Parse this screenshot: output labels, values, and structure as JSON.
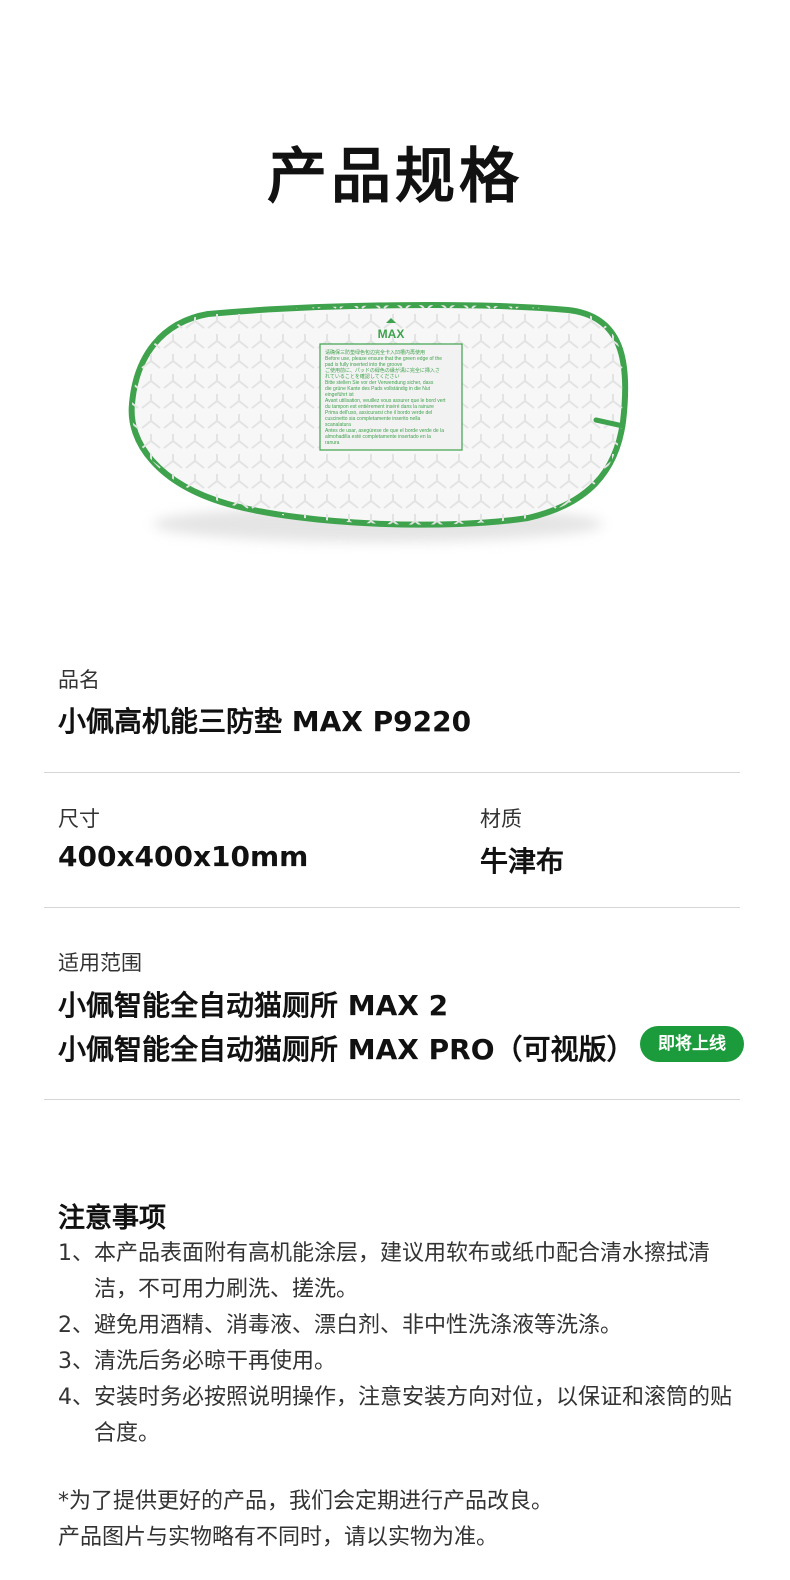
{
  "page_title": "产品规格",
  "product_image": {
    "pad_label": "MAX",
    "brand_color": "#3fa34d",
    "instructions": [
      "请确保三防垫绿色包边完全卡入凹槽内再使用",
      "Before use, please ensure that the green edge of the",
      "pad is fully inserted into the groove",
      "ご使用前に、パッドの緑色の縁が溝に完全に挿入さ",
      "れていることを確認してください",
      "Bitte stellen Sie vor der Verwendung sicher, dass",
      "die grüne Kante des Pads vollständig in die Nut",
      "eingeführt ist",
      "Avant utilisation, veuillez vous assurer que le bord vert",
      "du tampon est entièrement inséré dans la rainure",
      "Prima dell'uso, assicurarsi che il bordo verde del",
      "cuscinetto sia completamente inserito nella",
      "scanalatura",
      "Antes de usar, asegúrese de que el borde verde de la",
      "almohadilla esté completamente insertado en la",
      "ranura"
    ]
  },
  "specs": {
    "name": {
      "label": "品名",
      "value": "小佩高机能三防垫 MAX P9220"
    },
    "size": {
      "label": "尺寸",
      "value": "400x400x10mm"
    },
    "material": {
      "label": "材质",
      "value": "牛津布"
    },
    "compat": {
      "label": "适用范围",
      "line1": "小佩智能全自动猫厕所 MAX 2",
      "line2": "小佩智能全自动猫厕所 MAX PRO（可视版）",
      "badge": "即将上线"
    }
  },
  "notes": {
    "title": "注意事项",
    "items": [
      {
        "num": "1、",
        "text": "本产品表面附有高机能涂层，建议用软布或纸巾配合清水擦拭清洁，不可用力刷洗、搓洗。"
      },
      {
        "num": "2、",
        "text": "避免用酒精、消毒液、漂白剂、非中性洗涤液等洗涤。"
      },
      {
        "num": "3、",
        "text": "清洗后务必晾干再使用。"
      },
      {
        "num": "4、",
        "text": "安装时务必按照说明操作，注意安装方向对位，以保证和滚筒的贴合度。"
      }
    ]
  },
  "footer": {
    "line1": "*为了提供更好的产品，我们会定期进行产品改良。",
    "line2": "产品图片与实物略有不同时，请以实物为准。"
  }
}
